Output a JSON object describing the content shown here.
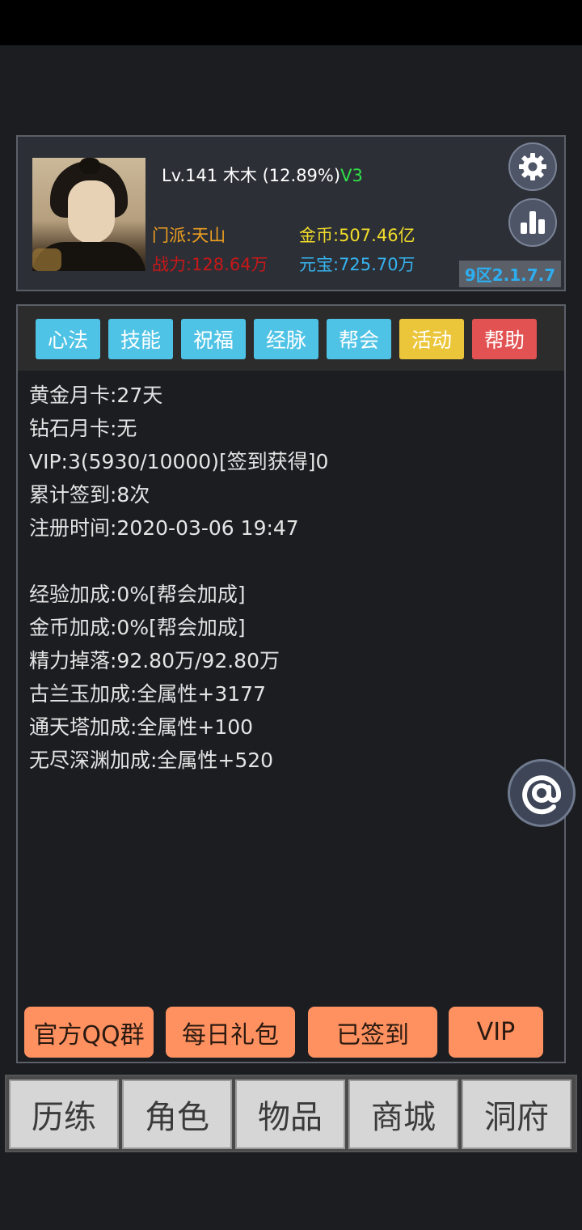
{
  "header": {
    "level_text": "Lv.141 木木 (12.89%)",
    "vip_tag": "V3",
    "sect": "门派:天山",
    "power": "战力:128.64万",
    "gold": "金币:507.46亿",
    "ingot": "元宝:725.70万",
    "server": "9区2.1.7.7"
  },
  "tabs": [
    {
      "label": "心法",
      "color": "#4fc3e6"
    },
    {
      "label": "技能",
      "color": "#4fc3e6"
    },
    {
      "label": "祝福",
      "color": "#4fc3e6"
    },
    {
      "label": "经脉",
      "color": "#4fc3e6"
    },
    {
      "label": "帮会",
      "color": "#4fc3e6"
    },
    {
      "label": "活动",
      "color": "#ecc63a"
    },
    {
      "label": "帮助",
      "color": "#e25252"
    }
  ],
  "info": {
    "gold_card": "黄金月卡:27天",
    "diamond_card": "钻石月卡:无",
    "vip": "VIP:3(5930/10000)[签到获得]0",
    "checkin": "累计签到:8次",
    "register": "注册时间:2020-03-06 19:47",
    "exp_bonus": "经验加成:0%[帮会加成]",
    "gold_bonus": "金币加成:0%[帮会加成]",
    "energy": "精力掉落:92.80万/92.80万",
    "gulan": "古兰玉加成:全属性+3177",
    "tower": "通天塔加成:全属性+100",
    "abyss": "无尽深渊加成:全属性+520"
  },
  "actions": {
    "qq": "官方QQ群",
    "gift": "每日礼包",
    "signed": "已签到",
    "vip": "VIP"
  },
  "nav": [
    "历练",
    "角色",
    "物品",
    "商城",
    "洞府"
  ],
  "icons": {
    "settings": "gear-icon",
    "rank": "bar-chart-icon",
    "float": "at-sign-icon"
  }
}
